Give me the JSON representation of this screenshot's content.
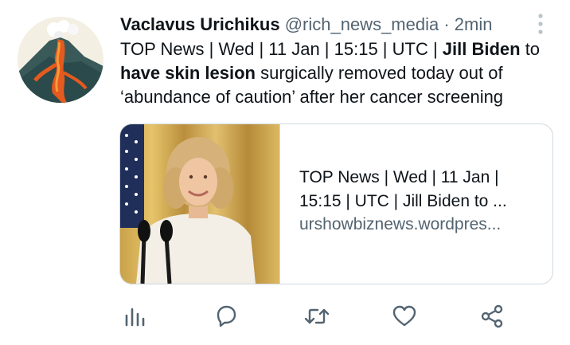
{
  "tweet": {
    "author_name": "Vaclavus Urichikus",
    "handle": "@rich_news_media",
    "separator": "·",
    "time": "2min",
    "text_parts": [
      "TOP News | Wed | 11 Jan | 15:15 | UTC | ",
      "Jill Biden",
      " to ",
      "have skin lesion",
      " surgically removed today out of ‘abundance of caution’ after her cancer screening"
    ]
  },
  "card": {
    "title": "TOP News | Wed | 11 Jan | 15:15 | UTC | Jill Biden to ...",
    "domain": "urshowbiznews.wordpres..."
  },
  "icons": {
    "avatar": "volcano-avatar",
    "more": "more-vertical-icon",
    "actions": [
      "analytics-icon",
      "reply-icon",
      "retweet-icon",
      "like-icon",
      "share-icon"
    ]
  },
  "colors": {
    "text": "#0f1419",
    "secondary": "#536471",
    "border": "#cfd9de",
    "more_icon": "#b9c3ca"
  }
}
